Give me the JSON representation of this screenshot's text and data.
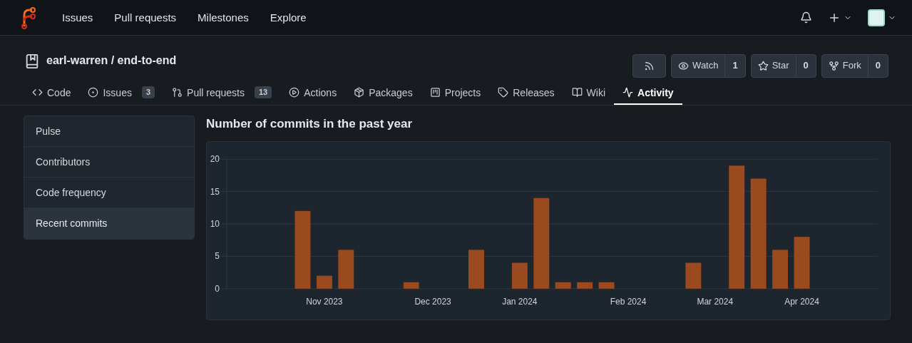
{
  "navbar": {
    "links": [
      {
        "label": "Issues"
      },
      {
        "label": "Pull requests"
      },
      {
        "label": "Milestones"
      },
      {
        "label": "Explore"
      }
    ]
  },
  "repo": {
    "title": "earl-warren / end-to-end",
    "buttons": [
      {
        "kind": "rss"
      },
      {
        "kind": "watch",
        "label": "Watch",
        "count": "1"
      },
      {
        "kind": "star",
        "label": "Star",
        "count": "0"
      },
      {
        "kind": "fork",
        "label": "Fork",
        "count": "0"
      }
    ]
  },
  "tabs": [
    {
      "kind": "code",
      "label": "Code",
      "selected": false
    },
    {
      "kind": "issues",
      "label": "Issues",
      "count": "3",
      "selected": false
    },
    {
      "kind": "pulls",
      "label": "Pull requests",
      "count": "13",
      "selected": false
    },
    {
      "kind": "actions",
      "label": "Actions",
      "selected": false
    },
    {
      "kind": "packages",
      "label": "Packages",
      "selected": false
    },
    {
      "kind": "projects",
      "label": "Projects",
      "selected": false
    },
    {
      "kind": "releases",
      "label": "Releases",
      "selected": false
    },
    {
      "kind": "wiki",
      "label": "Wiki",
      "selected": false
    },
    {
      "kind": "activity",
      "label": "Activity",
      "selected": true
    }
  ],
  "sidebar": {
    "items": [
      {
        "label": "Pulse",
        "selected": false
      },
      {
        "label": "Contributors",
        "selected": false
      },
      {
        "label": "Code frequency",
        "selected": false
      },
      {
        "label": "Recent commits",
        "selected": true
      }
    ]
  },
  "chart_title": "Number of commits in the past year",
  "chart_data": {
    "type": "bar",
    "categories": [
      null,
      null,
      null,
      null,
      "Nov 2023",
      null,
      null,
      null,
      null,
      "Dec 2023",
      null,
      null,
      null,
      "Jan 2024",
      null,
      null,
      null,
      null,
      "Feb 2024",
      null,
      null,
      null,
      "Mar 2024",
      null,
      null,
      null,
      "Apr 2024",
      null,
      null,
      null
    ],
    "series": [
      {
        "color": "#9a4a1e",
        "values": [
          null,
          null,
          null,
          12,
          2,
          6,
          null,
          null,
          1,
          null,
          null,
          6,
          null,
          4,
          14,
          1,
          1,
          1,
          null,
          null,
          null,
          4,
          null,
          19,
          17,
          6,
          8,
          null,
          null,
          null
        ]
      }
    ],
    "grid": true,
    "ylim": [
      0,
      20
    ],
    "yticks": [
      0,
      5,
      10,
      15,
      20
    ]
  }
}
